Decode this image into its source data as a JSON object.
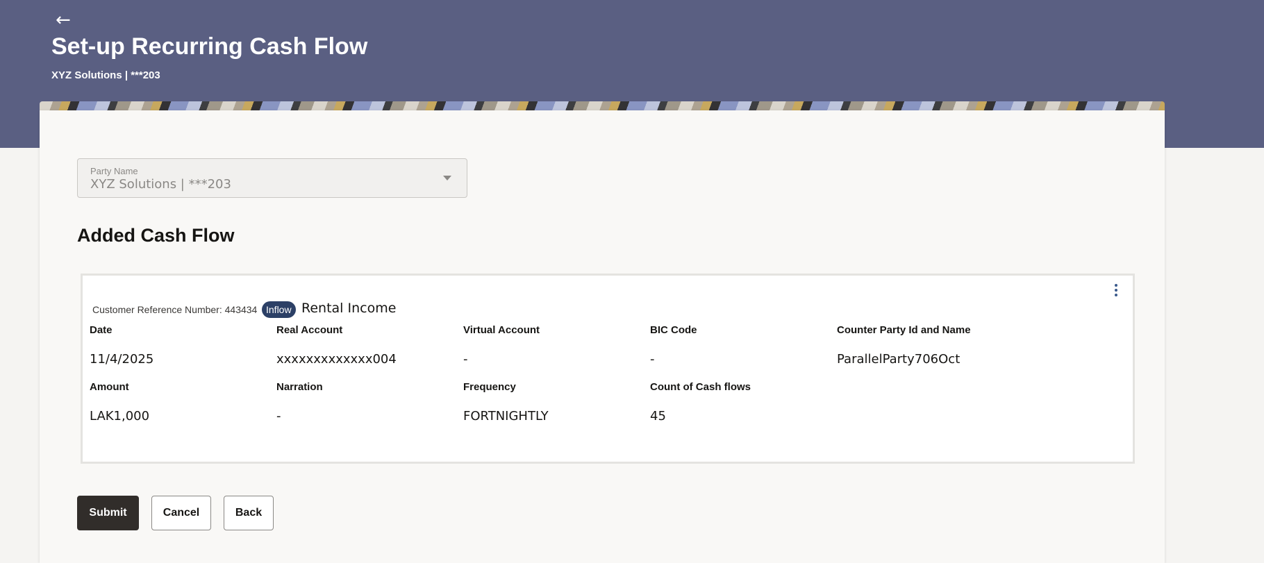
{
  "header": {
    "back_icon": "arrow-left-icon",
    "title": "Set-up Recurring Cash Flow",
    "subtitle": "XYZ Solutions | ***203"
  },
  "party_select": {
    "label": "Party Name",
    "value": "XYZ Solutions | ***203",
    "disabled": true
  },
  "section": {
    "title": "Added Cash Flow"
  },
  "cash_flow": {
    "reference": "Customer Reference Number: 443434",
    "badge": "Inflow",
    "name": "Rental Income",
    "fields": {
      "date": {
        "label": "Date",
        "value": "11/4/2025"
      },
      "real_account": {
        "label": "Real Account",
        "value": "xxxxxxxxxxxxx004"
      },
      "virtual_account": {
        "label": "Virtual Account",
        "value": "-"
      },
      "bic_code": {
        "label": "BIC Code",
        "value": "-"
      },
      "counter_party": {
        "label": "Counter Party Id and Name",
        "value": "ParallelParty706Oct"
      },
      "amount": {
        "label": "Amount",
        "value": "LAK1,000"
      },
      "narration": {
        "label": "Narration",
        "value": "-"
      },
      "frequency": {
        "label": "Frequency",
        "value": "FORTNIGHTLY"
      },
      "count": {
        "label": "Count of Cash flows",
        "value": "45"
      }
    }
  },
  "actions": {
    "submit": "Submit",
    "cancel": "Cancel",
    "back": "Back"
  },
  "colors": {
    "header_bg": "#5a5f82",
    "badge_bg": "#2c4066",
    "primary_button": "#312d2a"
  }
}
